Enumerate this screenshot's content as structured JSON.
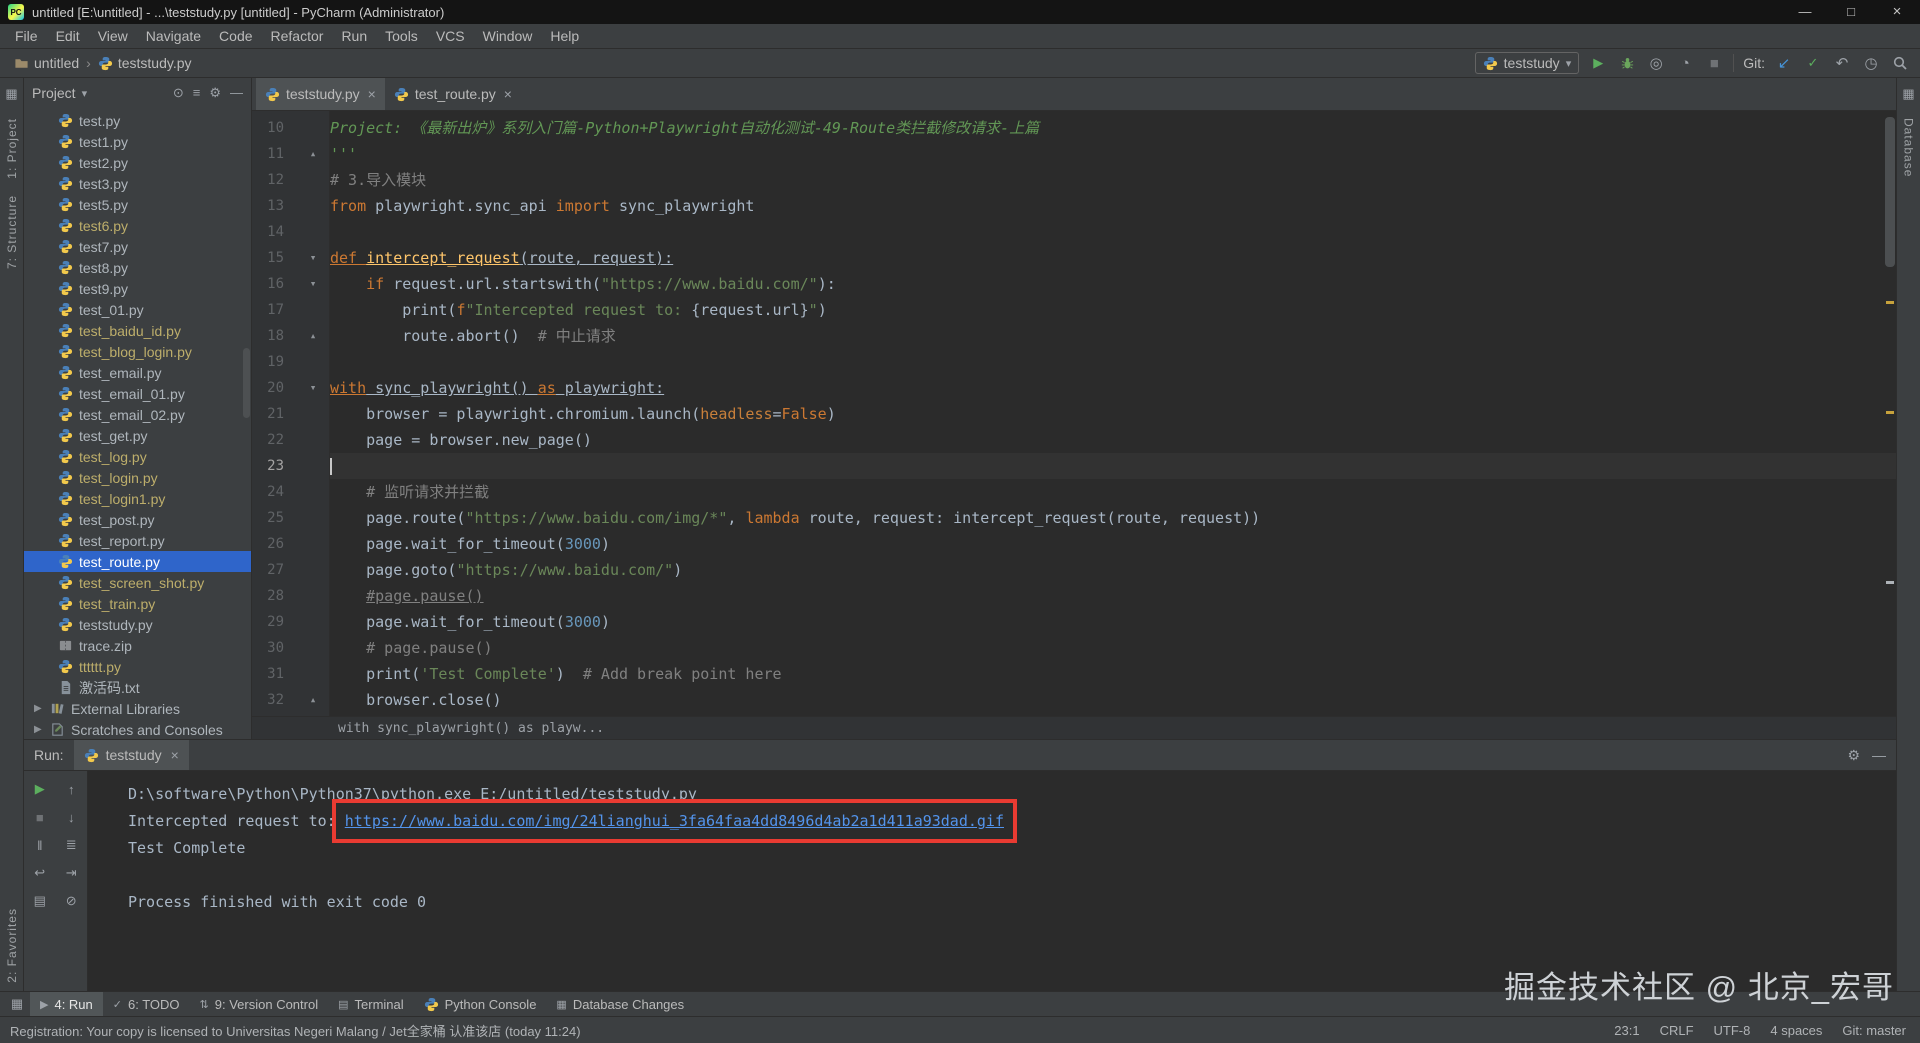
{
  "window": {
    "title": "untitled [E:\\untitled] - ...\\teststudy.py [untitled] - PyCharm (Administrator)"
  },
  "menu": [
    "File",
    "Edit",
    "View",
    "Navigate",
    "Code",
    "Refactor",
    "Run",
    "Tools",
    "VCS",
    "Window",
    "Help"
  ],
  "navbar": {
    "crumbs": [
      "untitled",
      "teststudy.py"
    ],
    "run_config": "teststudy",
    "git_label": "Git:"
  },
  "left_stripe": [
    "1: Project",
    "7: Structure",
    "2: Favorites"
  ],
  "right_stripe": [
    "Database"
  ],
  "project": {
    "header": "Project",
    "items": [
      {
        "name": "test.py",
        "type": "py"
      },
      {
        "name": "test1.py",
        "type": "py"
      },
      {
        "name": "test2.py",
        "type": "py"
      },
      {
        "name": "test3.py",
        "type": "py"
      },
      {
        "name": "test5.py",
        "type": "py"
      },
      {
        "name": "test6.py",
        "type": "py",
        "color": "gold"
      },
      {
        "name": "test7.py",
        "type": "py"
      },
      {
        "name": "test8.py",
        "type": "py"
      },
      {
        "name": "test9.py",
        "type": "py"
      },
      {
        "name": "test_01.py",
        "type": "py"
      },
      {
        "name": "test_baidu_id.py",
        "type": "py",
        "color": "gold"
      },
      {
        "name": "test_blog_login.py",
        "type": "py",
        "color": "gold"
      },
      {
        "name": "test_email.py",
        "type": "py"
      },
      {
        "name": "test_email_01.py",
        "type": "py"
      },
      {
        "name": "test_email_02.py",
        "type": "py"
      },
      {
        "name": "test_get.py",
        "type": "py"
      },
      {
        "name": "test_log.py",
        "type": "py",
        "color": "gold"
      },
      {
        "name": "test_login.py",
        "type": "py",
        "color": "gold"
      },
      {
        "name": "test_login1.py",
        "type": "py",
        "color": "gold"
      },
      {
        "name": "test_post.py",
        "type": "py"
      },
      {
        "name": "test_report.py",
        "type": "py"
      },
      {
        "name": "test_route.py",
        "type": "py",
        "selected": true
      },
      {
        "name": "test_screen_shot.py",
        "type": "py",
        "color": "gold"
      },
      {
        "name": "test_train.py",
        "type": "py",
        "color": "gold"
      },
      {
        "name": "teststudy.py",
        "type": "py"
      },
      {
        "name": "trace.zip",
        "type": "zip"
      },
      {
        "name": "tttttt.py",
        "type": "py",
        "color": "gold"
      },
      {
        "name": "激活码.txt",
        "type": "txt"
      }
    ],
    "special": [
      {
        "name": "External Libraries",
        "type": "lib"
      },
      {
        "name": "Scratches and Consoles",
        "type": "scratch"
      }
    ]
  },
  "editor": {
    "tabs": [
      {
        "label": "teststudy.py",
        "active": true
      },
      {
        "label": "test_route.py",
        "active": false
      }
    ],
    "current_line": 23,
    "breadcrumb": "with sync_playwright() as playw...",
    "lines": [
      {
        "n": 10,
        "t": [
          [
            "Project: 《最新出炉》系列入门篇-Python+Playwright自动化测试-49-Route类拦截修改请求-上篇",
            "doc"
          ]
        ]
      },
      {
        "n": 11,
        "t": [
          [
            "'''",
            "doc"
          ]
        ],
        "fold": "end"
      },
      {
        "n": 12,
        "t": [
          [
            "# 3.导入模块",
            "com"
          ]
        ]
      },
      {
        "n": 13,
        "t": [
          [
            "from",
            "kw"
          ],
          [
            " playwright.sync_api ",
            "d"
          ],
          [
            "import",
            "kw"
          ],
          [
            " sync_playwright",
            "d"
          ]
        ]
      },
      {
        "n": 14,
        "t": []
      },
      {
        "n": 15,
        "t": [
          [
            "def ",
            "kw u"
          ],
          [
            "intercept_request",
            "fn u"
          ],
          [
            "(route, request):",
            "d u"
          ]
        ],
        "fold": "down"
      },
      {
        "n": 16,
        "t": [
          [
            "    ",
            "d"
          ],
          [
            "if",
            "kw"
          ],
          [
            " request.url.startswith(",
            "d"
          ],
          [
            "\"https://www.baidu.com/\"",
            "str"
          ],
          [
            "):",
            "d"
          ]
        ],
        "fold": "down"
      },
      {
        "n": 17,
        "t": [
          [
            "        print(",
            "d"
          ],
          [
            "f",
            "kw"
          ],
          [
            "\"Intercepted request to: ",
            "str"
          ],
          [
            "{request.url}",
            "d"
          ],
          [
            "\"",
            "str"
          ],
          [
            ")",
            "d"
          ]
        ]
      },
      {
        "n": 18,
        "t": [
          [
            "        route.abort()  ",
            "d"
          ],
          [
            "# 中止请求",
            "com"
          ]
        ],
        "fold": "end"
      },
      {
        "n": 19,
        "t": []
      },
      {
        "n": 20,
        "t": [
          [
            "with",
            "kw u"
          ],
          [
            " sync_playwright() ",
            "d u"
          ],
          [
            "as",
            "kw u"
          ],
          [
            " playwright:",
            "d u"
          ]
        ],
        "fold": "down"
      },
      {
        "n": 21,
        "t": [
          [
            "    browser = playwright.chromium.launch(",
            "d"
          ],
          [
            "headless",
            "kwarg"
          ],
          [
            "=",
            "d"
          ],
          [
            "False",
            "kw"
          ],
          [
            ")",
            "d"
          ]
        ]
      },
      {
        "n": 22,
        "t": [
          [
            "    page = browser.new_page()",
            "d"
          ]
        ]
      },
      {
        "n": 23,
        "t": [],
        "caret": true
      },
      {
        "n": 24,
        "t": [
          [
            "    ",
            "d"
          ],
          [
            "# 监听请求并拦截",
            "com"
          ]
        ]
      },
      {
        "n": 25,
        "t": [
          [
            "    page.route(",
            "d"
          ],
          [
            "\"https://www.baidu.com/img/*\"",
            "str"
          ],
          [
            ", ",
            "d"
          ],
          [
            "lambda",
            "kw"
          ],
          [
            " route, request: intercept_request(route, request))",
            "d"
          ]
        ]
      },
      {
        "n": 26,
        "t": [
          [
            "    page.wait_for_timeout(",
            "d"
          ],
          [
            "3000",
            "num"
          ],
          [
            ")",
            "d"
          ]
        ]
      },
      {
        "n": 27,
        "t": [
          [
            "    page.goto(",
            "d"
          ],
          [
            "\"https://www.baidu.com/\"",
            "str"
          ],
          [
            ")",
            "d"
          ]
        ]
      },
      {
        "n": 28,
        "t": [
          [
            "    ",
            "d"
          ],
          [
            "#page.pause()",
            "com u"
          ]
        ]
      },
      {
        "n": 29,
        "t": [
          [
            "    page.wait_for_timeout(",
            "d"
          ],
          [
            "3000",
            "num"
          ],
          [
            ")",
            "d"
          ]
        ]
      },
      {
        "n": 30,
        "t": [
          [
            "    ",
            "d"
          ],
          [
            "# page.pause()",
            "com"
          ]
        ]
      },
      {
        "n": 31,
        "t": [
          [
            "    print(",
            "d"
          ],
          [
            "'Test Complete'",
            "str"
          ],
          [
            ")  ",
            "d"
          ],
          [
            "# Add break point here",
            "com"
          ]
        ]
      },
      {
        "n": 32,
        "t": [
          [
            "    browser.close()",
            "d"
          ]
        ],
        "fold": "end"
      }
    ]
  },
  "run": {
    "label": "Run:",
    "tab": "teststudy",
    "toolbar": [
      "rerun",
      "up",
      "stop",
      "down",
      "pause",
      "menu",
      "softwrap",
      "scroll_end",
      "print",
      "clear"
    ],
    "console": [
      {
        "t": [
          [
            "D:\\software\\Python\\Python37\\python.exe E:/untitled/teststudy.py",
            "d"
          ]
        ]
      },
      {
        "t": [
          [
            "Intercepted request to: ",
            "d"
          ],
          [
            "https://www.baidu.com/img/24lianghui_3fa64faa4dd8496d4ab2a1d411a93dad.gif",
            "link redbox"
          ]
        ]
      },
      {
        "t": [
          [
            "Test Complete",
            "d"
          ]
        ]
      },
      {
        "t": []
      },
      {
        "t": [
          [
            "Process finished with exit code 0",
            "d"
          ]
        ]
      }
    ]
  },
  "bottom_bar": {
    "items": [
      {
        "label": "4: Run",
        "icon": "run",
        "active": true
      },
      {
        "label": "6: TODO",
        "icon": "todo"
      },
      {
        "label": "9: Version Control",
        "icon": "vcs"
      },
      {
        "label": "Terminal",
        "icon": "terminal"
      },
      {
        "label": "Python Console",
        "icon": "py"
      },
      {
        "label": "Database Changes",
        "icon": "db"
      }
    ]
  },
  "status_bar": {
    "message": "Registration: Your copy is licensed to Universitas Negeri Malang / Jet全家桶 认准该店 (today 11:24)",
    "caret": "23:1",
    "line_sep": "CRLF",
    "encoding": "UTF-8",
    "indent": "4 spaces",
    "git": "Git: master"
  },
  "watermark": "掘金技术社区 @ 北京_宏哥",
  "icons": {
    "minimize": "—",
    "maximize": "□",
    "close": "×",
    "chevron_down": "▾",
    "crumb_sep": "›",
    "run": "▶",
    "stop": "■",
    "coverage": "◎",
    "profiler": "◔",
    "git_update": "↙",
    "git_commit": "✓",
    "git_revert": "↶",
    "history": "◷",
    "locate": "⊙",
    "collapse": "≡",
    "gear": "⚙",
    "hide": "—",
    "tree_arrow": "▶",
    "rerun": "▶",
    "up": "↑",
    "down": "↓",
    "pause": "‖",
    "softwrap": "↩",
    "scroll_end": "⇥",
    "print": "▤",
    "clear": "⊘",
    "menu": "≣",
    "switcher": "▦",
    "terminal": "▤",
    "db": "▦",
    "todo": "✓",
    "vcs": "⇅",
    "fold_down": "▾",
    "fold_end": "▴"
  },
  "colors": {
    "selection_blue": "#2f65ca",
    "editor_bg": "#2b2b2b",
    "panel_bg": "#3c3f41",
    "keyword": "#cc7832",
    "string": "#6a8759",
    "comment": "#808080",
    "docstring": "#629755",
    "number": "#6897bb",
    "function": "#ffc66b",
    "link": "#5394ec",
    "annotation_red": "#e93b32",
    "gold_file": "#bdae6b"
  }
}
